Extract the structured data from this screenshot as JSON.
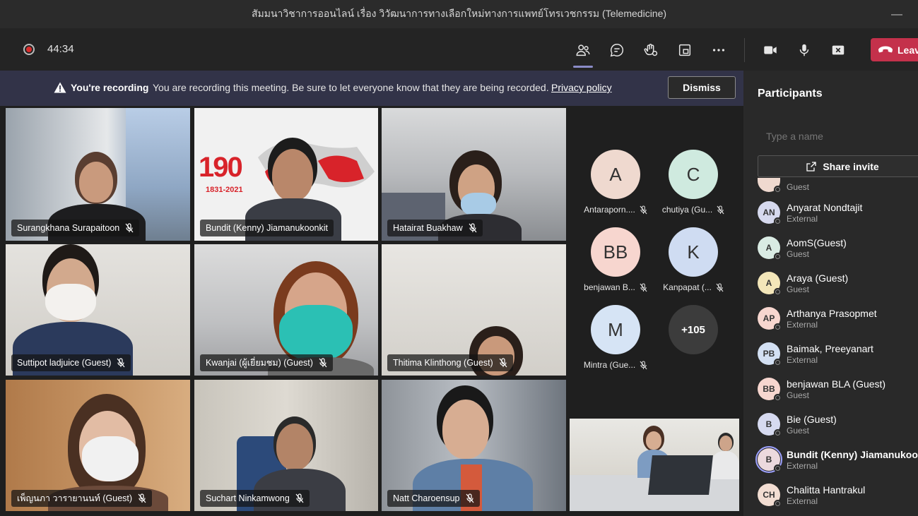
{
  "window": {
    "title": "สัมมนาวิชาการออนไลน์ เรื่อง วิวัฒนาการทางเลือกใหม่ทางการแพทย์โทรเวชกรรม (Telemedicine)",
    "minimize_glyph": "—"
  },
  "toolbar": {
    "timer": "44:34",
    "leave_label": "Leave",
    "icons": [
      "record-icon",
      "people-icon",
      "chat-icon",
      "reactions-icon",
      "layout-icon",
      "more-icon",
      "camera-icon",
      "microphone-icon",
      "share-screen-icon",
      "phone-icon"
    ]
  },
  "banner": {
    "strong": "You're recording",
    "text": "You are recording this meeting. Be sure to let everyone know that they are being recorded.",
    "link": "Privacy policy",
    "dismiss": "Dismiss"
  },
  "video_tiles": [
    {
      "name": "Surangkhana Surapaitoon"
    },
    {
      "name": "Bundit (Kenny) Jiamanukoonkit",
      "speaking": true,
      "banner_text": "190",
      "banner_years": "1831-2021"
    },
    {
      "name": "Hatairat Buakhaw"
    },
    {
      "name": "Suttipot ladjuice (Guest)"
    },
    {
      "name": "Kwanjai (ผู้เยี่ยมชม) (Guest)"
    },
    {
      "name": "Thitima Klinthong (Guest)"
    },
    {
      "name": "เพ็ญนภา วารายานนท์ (Guest)"
    },
    {
      "name": "Suchart Ninkamwong"
    },
    {
      "name": "Natt Charoensup"
    }
  ],
  "avatar_tiles": [
    {
      "initials": "A",
      "label": "Antaraporn....",
      "color": "#efd9cf"
    },
    {
      "initials": "C",
      "label": "chutiya (Gu...",
      "color": "#cfeadf"
    },
    {
      "initials": "BB",
      "label": "benjawan B...",
      "color": "#f7d6cf"
    },
    {
      "initials": "K",
      "label": "Kanpapat (...",
      "color": "#cfdcf2"
    },
    {
      "initials": "M",
      "label": "Mintra (Gue...",
      "color": "#d6e4f5"
    },
    {
      "initials": "+105",
      "label": "",
      "color": "#3c3c3c"
    }
  ],
  "participants": {
    "title": "Participants",
    "search_placeholder": "Type a name",
    "share_invite": "Share invite",
    "items": [
      {
        "initials": "A",
        "name": "",
        "role": "Guest",
        "color": "#efd9cf"
      },
      {
        "initials": "AN",
        "name": "Anyarat Nondtajit",
        "role": "External",
        "color": "#d6d9ee"
      },
      {
        "initials": "A",
        "name": "AomS(Guest)",
        "role": "Guest",
        "color": "#d9ebe3"
      },
      {
        "initials": "A",
        "name": "Araya (Guest)",
        "role": "Guest",
        "color": "#f3e6b9"
      },
      {
        "initials": "AP",
        "name": "Arthanya Prasopmet",
        "role": "External",
        "color": "#f7d6cf"
      },
      {
        "initials": "PB",
        "name": "Baimak, Preeyanart",
        "role": "External",
        "color": "#d3e0f3"
      },
      {
        "initials": "BB",
        "name": "benjawan BLA (Guest)",
        "role": "Guest",
        "color": "#f7d6cf"
      },
      {
        "initials": "B",
        "name": "Bie (Guest)",
        "role": "Guest",
        "color": "#d6daf0"
      },
      {
        "initials": "B",
        "name": "Bundit (Kenny) Jiamanukoon...",
        "role": "External",
        "color": "#ecd9de"
      },
      {
        "initials": "CH",
        "name": "Chalitta Hantrakul",
        "role": "External",
        "color": "#f2ddd2"
      }
    ]
  }
}
